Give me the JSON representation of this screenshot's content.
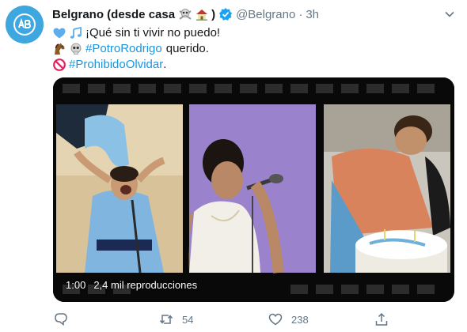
{
  "tweet": {
    "author_name": "Belgrano (desde casa",
    "author_name_end": ")",
    "handle": "@Belgrano",
    "separator": "·",
    "time": "3h",
    "line1_text": "¡Qué sin ti vivir no puedo!",
    "line2_hashtag": "#PotroRodrigo",
    "line2_text": "querido.",
    "line3_hashtag": "#ProhibidoOlvidar",
    "line3_text": "."
  },
  "video": {
    "duration": "1:00",
    "views": "2,4 mil reproducciones"
  },
  "actions": {
    "retweets": "54",
    "likes": "238"
  },
  "colors": {
    "link": "#1b95e0",
    "muted": "#657786",
    "verified": "#1da1f2",
    "avatar_bg": "#3fa7e0"
  },
  "icons": [
    "skull-crossbones-icon",
    "house-icon",
    "verified-badge-icon",
    "caret-down-icon",
    "blue-heart-icon",
    "music-notes-icon",
    "horse-icon",
    "skull-icon",
    "prohibited-icon",
    "reply-icon",
    "retweet-icon",
    "like-icon",
    "share-icon"
  ]
}
